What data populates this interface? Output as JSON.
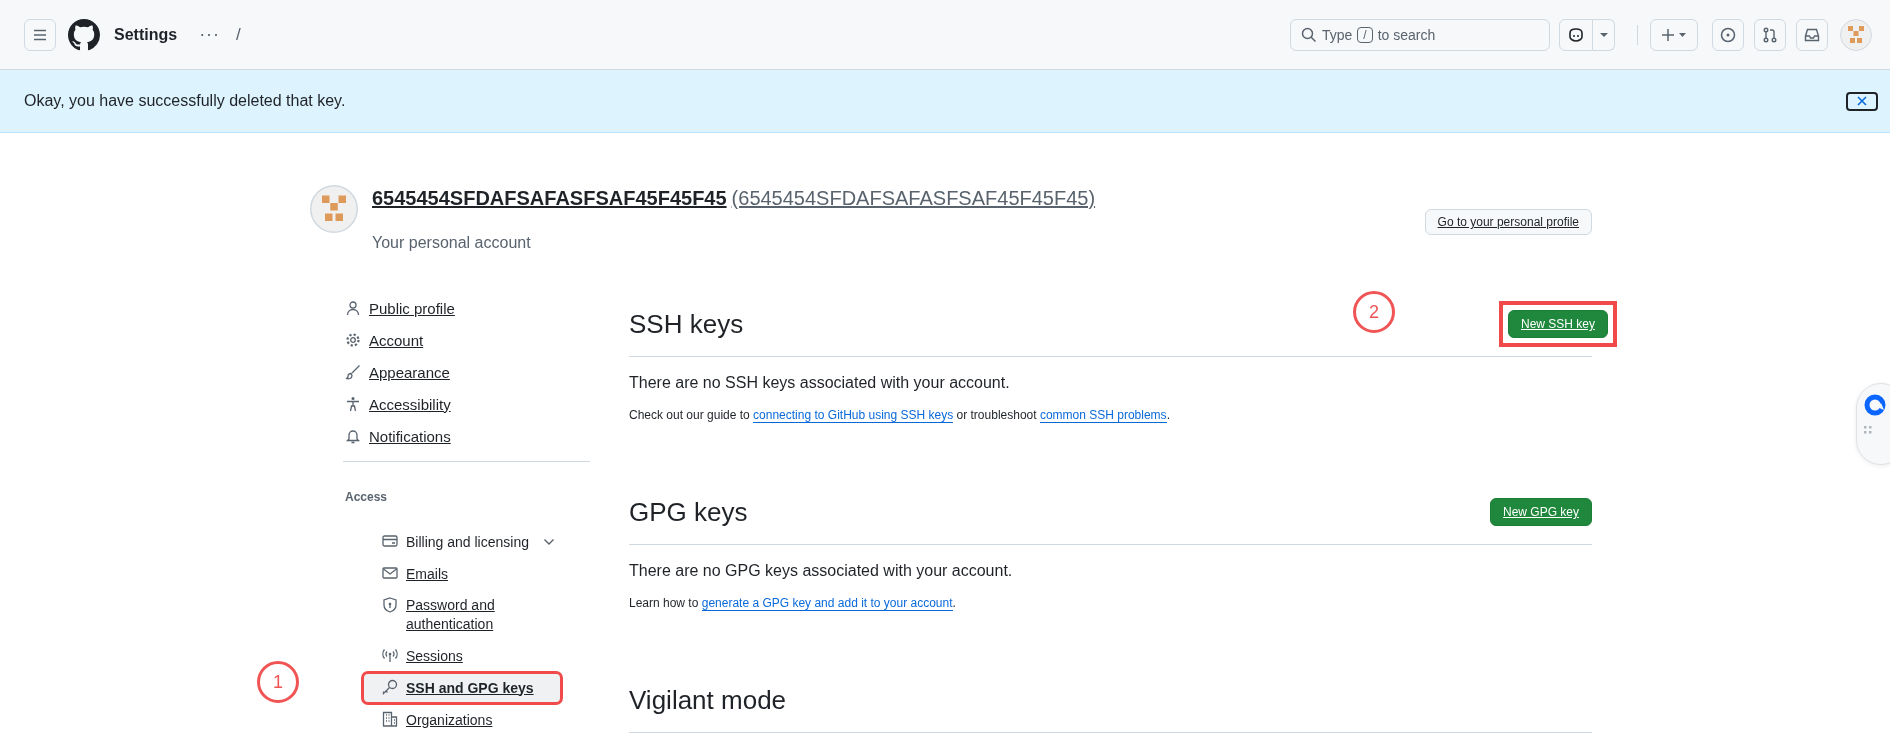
{
  "header": {
    "title": "Settings",
    "more": "···",
    "separator": "/",
    "search": {
      "placeholder_before": "Type",
      "key": "/",
      "placeholder_after": "to search"
    }
  },
  "flash": {
    "message": "Okay, you have successfully deleted that key."
  },
  "profile": {
    "name": "6545454SFDAFSAFASFSAF45F45F45",
    "login": "(6545454SFDAFSAFASFSAF45F45F45)",
    "subtitle": "Your personal account",
    "button": "Go to your personal profile"
  },
  "sidebar": {
    "items": [
      {
        "label": "Public profile",
        "selected": false
      },
      {
        "label": "Account",
        "selected": false
      },
      {
        "label": "Appearance",
        "selected": false
      },
      {
        "label": "Accessibility",
        "selected": false
      },
      {
        "label": "Notifications",
        "selected": false
      }
    ],
    "section": "Access",
    "access_items": [
      {
        "label": "Billing and licensing",
        "selected": false,
        "expandable": true,
        "link": false,
        "highlighted": false
      },
      {
        "label": "Emails",
        "selected": false,
        "expandable": false,
        "link": true,
        "highlighted": false
      },
      {
        "label": "Password and authentication",
        "selected": false,
        "expandable": false,
        "link": true,
        "highlighted": false
      },
      {
        "label": "Sessions",
        "selected": false,
        "expandable": false,
        "link": true,
        "highlighted": false
      },
      {
        "label": "SSH and GPG keys",
        "selected": true,
        "expandable": false,
        "link": true,
        "highlighted": true,
        "annotation": "1"
      },
      {
        "label": "Organizations",
        "selected": false,
        "expandable": false,
        "link": true,
        "highlighted": false
      }
    ]
  },
  "sections": [
    {
      "title": "SSH keys",
      "button": {
        "label": "New SSH key",
        "highlighted": true,
        "annotation": "2"
      },
      "empty": "There are no SSH keys associated with your account.",
      "help": [
        {
          "text": "Check out our guide to "
        },
        {
          "link": "connecting to GitHub using SSH keys"
        },
        {
          "text": " or troubleshoot "
        },
        {
          "link": "common SSH problems"
        },
        {
          "text": "."
        }
      ]
    },
    {
      "title": "GPG keys",
      "button": {
        "label": "New GPG key",
        "highlighted": false
      },
      "empty": "There are no GPG keys associated with your account.",
      "help": [
        {
          "text": "Learn how to "
        },
        {
          "link": "generate a GPG key and add it to your account"
        },
        {
          "text": "."
        }
      ]
    },
    {
      "title": "Vigilant mode"
    }
  ]
}
